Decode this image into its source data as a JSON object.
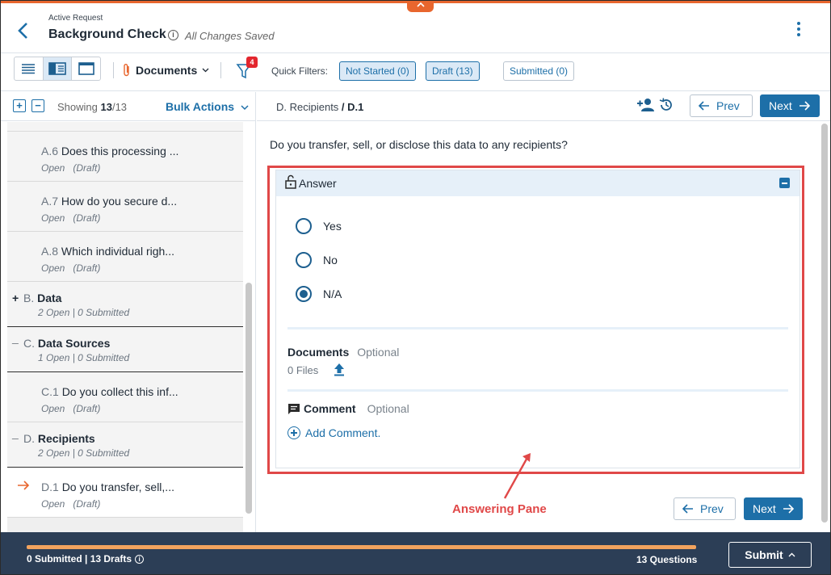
{
  "header": {
    "breadcrumb": "Active Request",
    "title": "Background Check",
    "status": "All Changes Saved"
  },
  "toolbar": {
    "documents_label": "Documents",
    "filter_count": "4",
    "quick_filters_label": "Quick Filters:",
    "chips": [
      "Not Started (0)",
      "Draft (13)",
      "Submitted (0)"
    ]
  },
  "left": {
    "showing_prefix": "Showing",
    "showing_count": "13",
    "showing_total": "/13",
    "bulk_actions": "Bulk Actions",
    "items": [
      {
        "code": "A.6",
        "text": "Does this processing ...",
        "status": "Open",
        "state": "(Draft)"
      },
      {
        "code": "A.7",
        "text": "How do you secure d...",
        "status": "Open",
        "state": "(Draft)"
      },
      {
        "code": "A.8",
        "text": "Which individual righ...",
        "status": "Open",
        "state": "(Draft)"
      }
    ],
    "sections": [
      {
        "sym": "+",
        "code": "B.",
        "name": "Data",
        "summary": "2 Open | 0 Submitted"
      },
      {
        "sym": "_",
        "code": "C.",
        "name": "Data Sources",
        "summary": "1 Open | 0 Submitted"
      },
      {
        "sym": "_",
        "code": "D.",
        "name": "Recipients",
        "summary": "2 Open | 0 Submitted"
      }
    ],
    "c1": {
      "code": "C.1",
      "text": "Do you collect this inf...",
      "status": "Open",
      "state": "(Draft)"
    },
    "d1": {
      "code": "D.1",
      "text": "Do you transfer, sell,...",
      "status": "Open",
      "state": "(Draft)"
    }
  },
  "right": {
    "crumb_section": "D. Recipients",
    "crumb_sep": " / ",
    "crumb_item": "D.1",
    "prev": "Prev",
    "next": "Next",
    "question": "Do you transfer, sell, or disclose this data to any recipients?",
    "answer_title": "Answer",
    "options": [
      "Yes",
      "No",
      "N/A"
    ],
    "selected": "N/A",
    "documents_label": "Documents",
    "optional": "Optional",
    "files": "0 Files",
    "comment_label": "Comment",
    "add_comment": "Add Comment."
  },
  "annotation": "Answering Pane",
  "footer": {
    "summary": "0 Submitted | 13 Drafts",
    "questions": "13 Questions",
    "submit": "Submit",
    "progress": 1.0
  },
  "colors": {
    "accent": "#1d6fa8",
    "orange": "#e8662e",
    "footer": "#2c3e56",
    "annotation": "#e04848"
  }
}
